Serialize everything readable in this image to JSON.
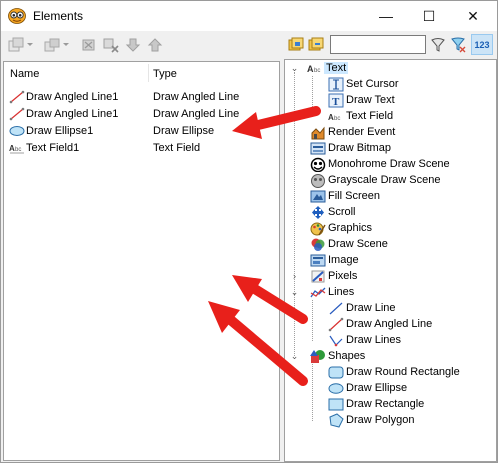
{
  "window": {
    "title": "Elements",
    "minimize_glyph": "—",
    "maximize_glyph": "☐",
    "close_glyph": "✕"
  },
  "left_toolbar": {
    "icons": [
      "add-element-icon",
      "add-group-icon",
      "cut-icon",
      "delete-icon",
      "move-down-icon",
      "move-up-icon"
    ]
  },
  "elements_list": {
    "columns": [
      "Name",
      "Type"
    ],
    "rows": [
      {
        "name": "Draw Angled Line1",
        "type": "Draw Angled Line",
        "icon": "angled-line-icon"
      },
      {
        "name": "Draw Angled Line1",
        "type": "Draw Angled Line",
        "icon": "angled-line-icon"
      },
      {
        "name": "Draw Ellipse1",
        "type": "Draw Ellipse",
        "icon": "ellipse-icon"
      },
      {
        "name": "Text Field1",
        "type": "Text Field",
        "icon": "text-field-icon"
      }
    ]
  },
  "right_toolbar": {
    "search_value": "",
    "sort_label": "123"
  },
  "tree": {
    "items": [
      {
        "label": "Text",
        "icon": "text-icon",
        "level": 0,
        "expanded": true,
        "selected": true
      },
      {
        "label": "Set Cursor",
        "icon": "cursor-icon",
        "level": 1
      },
      {
        "label": "Draw Text",
        "icon": "draw-text-icon",
        "level": 1
      },
      {
        "label": "Text Field",
        "icon": "text-field-icon",
        "level": 1
      },
      {
        "label": "Render Event",
        "icon": "render-event-icon",
        "level": 0
      },
      {
        "label": "Draw Bitmap",
        "icon": "bitmap-icon",
        "level": 0
      },
      {
        "label": "Monohrome Draw Scene",
        "icon": "mono-scene-icon",
        "level": 0
      },
      {
        "label": "Grayscale Draw Scene",
        "icon": "gray-scene-icon",
        "level": 0
      },
      {
        "label": "Fill Screen",
        "icon": "fill-screen-icon",
        "level": 0
      },
      {
        "label": "Scroll",
        "icon": "scroll-icon",
        "level": 0
      },
      {
        "label": "Graphics",
        "icon": "graphics-icon",
        "level": 0
      },
      {
        "label": "Draw Scene",
        "icon": "draw-scene-icon",
        "level": 0
      },
      {
        "label": "Image",
        "icon": "image-icon",
        "level": 0
      },
      {
        "label": "Pixels",
        "icon": "pixels-icon",
        "level": 0,
        "collapsed": true
      },
      {
        "label": "Lines",
        "icon": "lines-icon",
        "level": 0,
        "expanded": true
      },
      {
        "label": "Draw Line",
        "icon": "line-icon",
        "level": 1
      },
      {
        "label": "Draw Angled Line",
        "icon": "angled-line-icon",
        "level": 1
      },
      {
        "label": "Draw Lines",
        "icon": "draw-lines-icon",
        "level": 1
      },
      {
        "label": "Shapes",
        "icon": "shapes-icon",
        "level": 0,
        "expanded": true
      },
      {
        "label": "Draw Round Rectangle",
        "icon": "round-rect-icon",
        "level": 1
      },
      {
        "label": "Draw Ellipse",
        "icon": "ellipse-icon",
        "level": 1
      },
      {
        "label": "Draw Rectangle",
        "icon": "rectangle-icon",
        "level": 1
      },
      {
        "label": "Draw Polygon",
        "icon": "polygon-icon",
        "level": 1
      }
    ]
  },
  "colors": {
    "annotation_arrow": "#e8201b",
    "selection": "#cce8ff",
    "sort_active": "#cce4f7"
  }
}
